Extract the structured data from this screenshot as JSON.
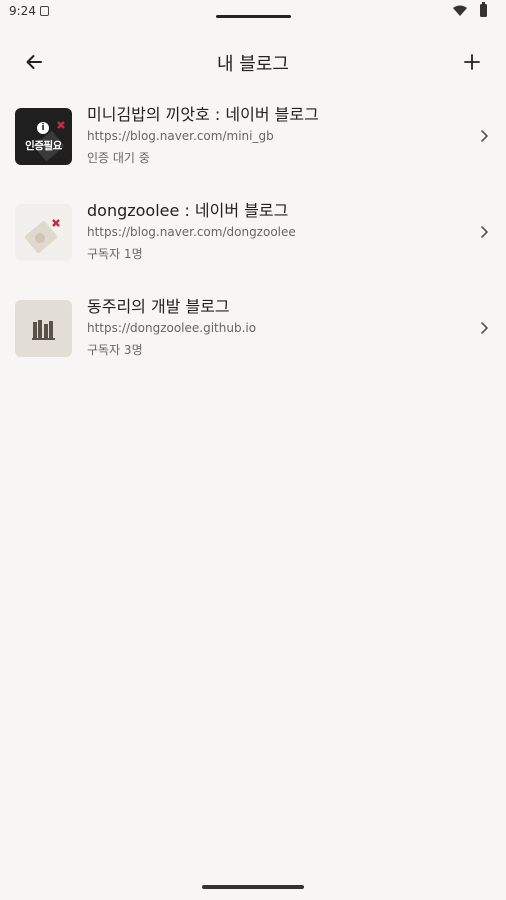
{
  "status_bar": {
    "time": "9:24"
  },
  "header": {
    "title": "내 블로그"
  },
  "blogs": [
    {
      "title": "미니김밥의 끼앗호 : 네이버 블로그",
      "url": "https://blog.naver.com/mini_gb",
      "status": "인증 대기 중",
      "thumb_label": "인증필요",
      "thumb_icon": "info-icon"
    },
    {
      "title": "dongzoolee : 네이버 블로그",
      "url": "https://blog.naver.com/dongzoolee",
      "status": "구독자 1명",
      "thumb_icon": "tag-icon"
    },
    {
      "title": "동주리의 개발 블로그",
      "url": "https://dongzoolee.github.io",
      "status": "구독자 3명",
      "thumb_icon": "books-icon"
    }
  ]
}
